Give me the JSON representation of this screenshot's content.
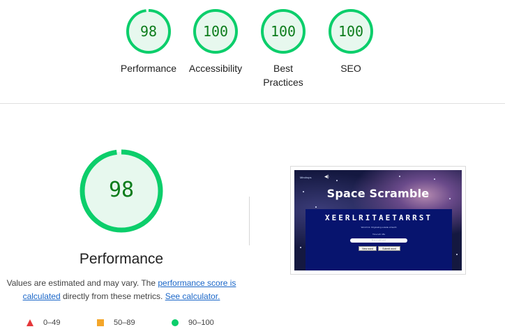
{
  "categories": [
    {
      "key": "performance",
      "score": "98",
      "label": "Performance",
      "fraction": 0.98
    },
    {
      "key": "accessibility",
      "score": "100",
      "label": "Accessibility",
      "fraction": 1.0
    },
    {
      "key": "best-practices",
      "score": "100",
      "label": "Best Practices",
      "fraction": 1.0
    },
    {
      "key": "seo",
      "score": "100",
      "label": "SEO",
      "fraction": 1.0
    }
  ],
  "colors": {
    "pass": "#0cce6b",
    "pass_text": "#0c7c1b",
    "pass_bg": "#e7f8ee",
    "average": "#f4a62a",
    "fail": "#e5373a",
    "link": "#1a66c8"
  },
  "main": {
    "score": "98",
    "fraction": 0.98,
    "title": "Performance",
    "desc_prefix": "Values are estimated and may vary. The ",
    "link_score": "performance score is calculated",
    "desc_middle": " directly from these metrics. ",
    "link_calc": "See calculator."
  },
  "legend": [
    {
      "icon": "fail-triangle-icon",
      "range": "0–49"
    },
    {
      "icon": "average-square-icon",
      "range": "50–89"
    },
    {
      "icon": "pass-circle-icon",
      "range": "90–100"
    }
  ],
  "screenshot": {
    "brand": "Mindrops",
    "speaker_icon": "speaker-icon",
    "title": "Space Scramble",
    "scrambled_word": "XEERLRITAETARRST",
    "hint": "Word hint: Originating outside of Earth",
    "time": "Time left: 18s",
    "input_placeholder": "Enter a valid word",
    "new_word_label": "New word",
    "submit_label": "Submit word"
  }
}
